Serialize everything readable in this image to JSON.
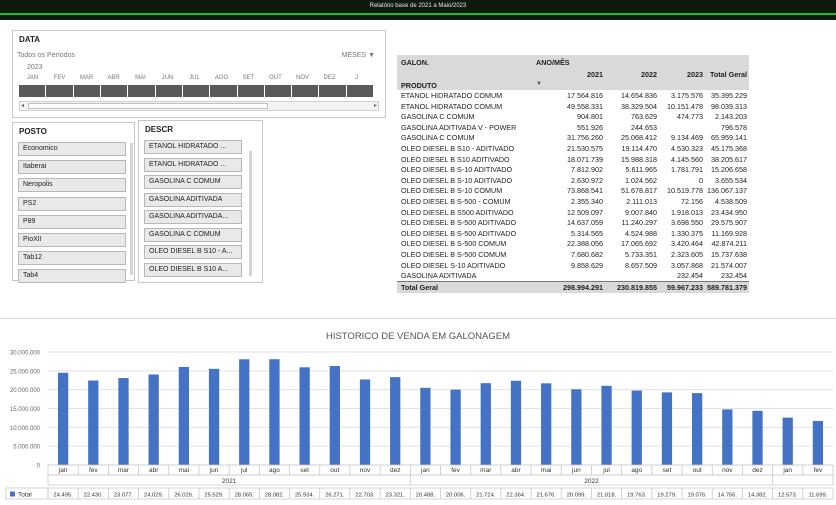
{
  "header": {
    "title": "Relatório base de 2021 a Maio/2023"
  },
  "timeline": {
    "title": "DATA",
    "caption": "Todos os Períodos",
    "level": "MESES",
    "level_arrow": "▼",
    "year": "2023",
    "months": [
      "JAN",
      "FEV",
      "MAR",
      "ABR",
      "MAI",
      "JUN",
      "JUL",
      "AGO",
      "SET",
      "OUT",
      "NOV",
      "DEZ",
      "J"
    ]
  },
  "posto": {
    "title": "POSTO",
    "items": [
      "Economico",
      "Itaberai",
      "Neropolis",
      "PS2",
      "P89",
      "PioXII",
      "Tab12",
      "Tab4"
    ]
  },
  "descr": {
    "title": "DESCR",
    "items": [
      "ETANOL HIDRATADO ...",
      "ETANOL HIDRATADO ...",
      "GASOLINA  C COMUM",
      "GASOLINA ADITIVADA",
      "GASOLINA ADITIVADA...",
      "GASOLINA C COMUM",
      "OLEO DIESEL B S10 - A...",
      "OLEO DIESEL B S10 A..."
    ]
  },
  "pivot": {
    "measure": "GALON.",
    "col_field": "ANO/MÊS",
    "row_field": "PRODUTO",
    "filter_icon": "▼",
    "columns": [
      "2021",
      "2022",
      "2023",
      "Total Geral"
    ],
    "rows": [
      {
        "label": "ETANOL HIDRATADO  COMUM",
        "values": [
          "17.564.816",
          "14.654.836",
          "3.175.576",
          "35.395.229"
        ]
      },
      {
        "label": "ETANOL HIDRATADO COMUM",
        "values": [
          "49.558.331",
          "38.329.504",
          "10.151.478",
          "98.039.313"
        ]
      },
      {
        "label": "GASOLINA  C COMUM",
        "values": [
          "904.801",
          "763.629",
          "474.773",
          "2.143.203"
        ]
      },
      {
        "label": "GASOLINA ADITIVADA  V - POWER",
        "values": [
          "551.926",
          "244.653",
          "",
          "796.578"
        ]
      },
      {
        "label": "GASOLINA C COMUM",
        "values": [
          "31.756.260",
          "25.068.412",
          "9.134.469",
          "65.959.141"
        ]
      },
      {
        "label": "OLEO DIESEL B S10 - ADITIVADO",
        "values": [
          "21.530.575",
          "19.114.470",
          "4.530.323",
          "45.175.368"
        ]
      },
      {
        "label": "OLEO DIESEL B S10 ADITIVADO",
        "values": [
          "18.071.739",
          "15.988.318",
          "4.145.560",
          "38.205.617"
        ]
      },
      {
        "label": "OLEO DIESEL B S-10 ADITIVADO",
        "values": [
          "7.812.902",
          "5.611.965",
          "1.781.791",
          "15.206.658"
        ]
      },
      {
        "label": "OLEO DIESEL B S-10 ADITIVADO",
        "values": [
          "2.630.972",
          "1.024.562",
          "0",
          "3.655.534"
        ]
      },
      {
        "label": "OLEO DIESEL B S-10 COMUM",
        "values": [
          "73.868.541",
          "51.678.817",
          "10.519.778",
          "136.067.137"
        ]
      },
      {
        "label": "OLEO DIESEL B S-500 - COMUM",
        "values": [
          "2.355.340",
          "2.111.013",
          "72.156",
          "4.538.509"
        ]
      },
      {
        "label": "OLEO DIESEL B S500 ADITIVADO",
        "values": [
          "12.509.097",
          "9.007.840",
          "1.918.013",
          "23.434.950"
        ]
      },
      {
        "label": "OLEO DIESEL B S-500 ADITIVADO",
        "values": [
          "14.637.059",
          "11.240.297",
          "3.698.550",
          "29.575.907"
        ]
      },
      {
        "label": "OLEO DIESEL B S-500 ADITIVADO",
        "values": [
          "5.314.565",
          "4.524.988",
          "1.330.375",
          "11.169.928"
        ]
      },
      {
        "label": "OLEO DIESEL B S-500 COMUM",
        "values": [
          "22.388.056",
          "17.065.692",
          "3.420.464",
          "42.874.211"
        ]
      },
      {
        "label": "OLEO DIESEL B S-500 COMUM",
        "values": [
          "7.680.682",
          "5.733.351",
          "2.323.605",
          "15.737.638"
        ]
      },
      {
        "label": "OLEO DIESEL S-10 ADITIVADO",
        "values": [
          "9.858.629",
          "8.657.509",
          "3.057.868",
          "21.574.007"
        ]
      },
      {
        "label": "GASOLINA ADITIVADA",
        "values": [
          "",
          "",
          "232.454",
          "232.454"
        ]
      }
    ],
    "total": {
      "label": "Total Geral",
      "values": [
        "298.994.291",
        "230.819.855",
        "59.967.233",
        "589.781.379"
      ]
    }
  },
  "chart_data": {
    "type": "bar",
    "title": "HISTORICO DE VENDA EM GALONAGEM",
    "series": [
      {
        "name": "Total",
        "values": [
          24495000,
          22430000,
          23077000,
          24029000,
          26026000,
          25529000,
          28065000,
          28082000,
          25934000,
          26271000,
          22703000,
          23321000,
          20488000,
          20006000,
          21724000,
          22364000,
          21676000,
          20099000,
          21018000,
          19763000,
          19279000,
          19076000,
          14756000,
          14382000,
          12573000,
          11699000
        ]
      }
    ],
    "categories": [
      "jan",
      "fev",
      "mar",
      "abr",
      "mai",
      "jun",
      "jul",
      "ago",
      "set",
      "out",
      "nov",
      "dez",
      "jan",
      "fev",
      "mar",
      "abr",
      "mai",
      "jun",
      "jul",
      "ago",
      "set",
      "out",
      "nov",
      "dez",
      "jan",
      "fev"
    ],
    "year_groups": [
      {
        "label": "2021",
        "count": 12
      },
      {
        "label": "2022",
        "count": 12
      },
      {
        "label": "",
        "count": 2
      }
    ],
    "table_values": [
      "24.495.",
      "22.430.",
      "23.077.",
      "24.029.",
      "26.026.",
      "25.529.",
      "28.065.",
      "28.082.",
      "25.934.",
      "26.271.",
      "22.703.",
      "23.321.",
      "20.488.",
      "20.006.",
      "21.724.",
      "22.364.",
      "21.676.",
      "20.099.",
      "21.018.",
      "19.763.",
      "19.279.",
      "19.076.",
      "14.756.",
      "14.382.",
      "12.573.",
      "11.699."
    ],
    "ylim": [
      0,
      30000000
    ],
    "yticks": [
      "0",
      "5.000.000",
      "10.000.000",
      "15.000.000",
      "20.000.000",
      "25.000.000",
      "30.000.000"
    ],
    "grid": true,
    "legend": "data table",
    "bar_color": "#4472c4"
  }
}
